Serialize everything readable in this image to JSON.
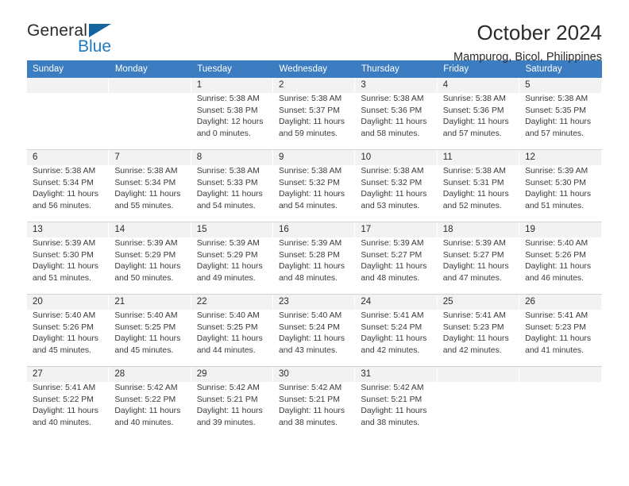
{
  "brand": {
    "name_part1": "General",
    "name_part2": "Blue",
    "flag_icon": "triangle-flag-icon",
    "accent_color": "#1f7ac0",
    "flag_color": "#1464a0"
  },
  "header": {
    "title": "October 2024",
    "subtitle": "Mampurog, Bicol, Philippines"
  },
  "calendar": {
    "header_bg": "#3b7dc0",
    "header_text_color": "#ffffff",
    "weekday_headers": [
      "Sunday",
      "Monday",
      "Tuesday",
      "Wednesday",
      "Thursday",
      "Friday",
      "Saturday"
    ],
    "weeks": [
      [
        {
          "day": "",
          "info": ""
        },
        {
          "day": "",
          "info": ""
        },
        {
          "day": "1",
          "info": "Sunrise: 5:38 AM\nSunset: 5:38 PM\nDaylight: 12 hours\nand 0 minutes."
        },
        {
          "day": "2",
          "info": "Sunrise: 5:38 AM\nSunset: 5:37 PM\nDaylight: 11 hours\nand 59 minutes."
        },
        {
          "day": "3",
          "info": "Sunrise: 5:38 AM\nSunset: 5:36 PM\nDaylight: 11 hours\nand 58 minutes."
        },
        {
          "day": "4",
          "info": "Sunrise: 5:38 AM\nSunset: 5:36 PM\nDaylight: 11 hours\nand 57 minutes."
        },
        {
          "day": "5",
          "info": "Sunrise: 5:38 AM\nSunset: 5:35 PM\nDaylight: 11 hours\nand 57 minutes."
        }
      ],
      [
        {
          "day": "6",
          "info": "Sunrise: 5:38 AM\nSunset: 5:34 PM\nDaylight: 11 hours\nand 56 minutes."
        },
        {
          "day": "7",
          "info": "Sunrise: 5:38 AM\nSunset: 5:34 PM\nDaylight: 11 hours\nand 55 minutes."
        },
        {
          "day": "8",
          "info": "Sunrise: 5:38 AM\nSunset: 5:33 PM\nDaylight: 11 hours\nand 54 minutes."
        },
        {
          "day": "9",
          "info": "Sunrise: 5:38 AM\nSunset: 5:32 PM\nDaylight: 11 hours\nand 54 minutes."
        },
        {
          "day": "10",
          "info": "Sunrise: 5:38 AM\nSunset: 5:32 PM\nDaylight: 11 hours\nand 53 minutes."
        },
        {
          "day": "11",
          "info": "Sunrise: 5:38 AM\nSunset: 5:31 PM\nDaylight: 11 hours\nand 52 minutes."
        },
        {
          "day": "12",
          "info": "Sunrise: 5:39 AM\nSunset: 5:30 PM\nDaylight: 11 hours\nand 51 minutes."
        }
      ],
      [
        {
          "day": "13",
          "info": "Sunrise: 5:39 AM\nSunset: 5:30 PM\nDaylight: 11 hours\nand 51 minutes."
        },
        {
          "day": "14",
          "info": "Sunrise: 5:39 AM\nSunset: 5:29 PM\nDaylight: 11 hours\nand 50 minutes."
        },
        {
          "day": "15",
          "info": "Sunrise: 5:39 AM\nSunset: 5:29 PM\nDaylight: 11 hours\nand 49 minutes."
        },
        {
          "day": "16",
          "info": "Sunrise: 5:39 AM\nSunset: 5:28 PM\nDaylight: 11 hours\nand 48 minutes."
        },
        {
          "day": "17",
          "info": "Sunrise: 5:39 AM\nSunset: 5:27 PM\nDaylight: 11 hours\nand 48 minutes."
        },
        {
          "day": "18",
          "info": "Sunrise: 5:39 AM\nSunset: 5:27 PM\nDaylight: 11 hours\nand 47 minutes."
        },
        {
          "day": "19",
          "info": "Sunrise: 5:40 AM\nSunset: 5:26 PM\nDaylight: 11 hours\nand 46 minutes."
        }
      ],
      [
        {
          "day": "20",
          "info": "Sunrise: 5:40 AM\nSunset: 5:26 PM\nDaylight: 11 hours\nand 45 minutes."
        },
        {
          "day": "21",
          "info": "Sunrise: 5:40 AM\nSunset: 5:25 PM\nDaylight: 11 hours\nand 45 minutes."
        },
        {
          "day": "22",
          "info": "Sunrise: 5:40 AM\nSunset: 5:25 PM\nDaylight: 11 hours\nand 44 minutes."
        },
        {
          "day": "23",
          "info": "Sunrise: 5:40 AM\nSunset: 5:24 PM\nDaylight: 11 hours\nand 43 minutes."
        },
        {
          "day": "24",
          "info": "Sunrise: 5:41 AM\nSunset: 5:24 PM\nDaylight: 11 hours\nand 42 minutes."
        },
        {
          "day": "25",
          "info": "Sunrise: 5:41 AM\nSunset: 5:23 PM\nDaylight: 11 hours\nand 42 minutes."
        },
        {
          "day": "26",
          "info": "Sunrise: 5:41 AM\nSunset: 5:23 PM\nDaylight: 11 hours\nand 41 minutes."
        }
      ],
      [
        {
          "day": "27",
          "info": "Sunrise: 5:41 AM\nSunset: 5:22 PM\nDaylight: 11 hours\nand 40 minutes."
        },
        {
          "day": "28",
          "info": "Sunrise: 5:42 AM\nSunset: 5:22 PM\nDaylight: 11 hours\nand 40 minutes."
        },
        {
          "day": "29",
          "info": "Sunrise: 5:42 AM\nSunset: 5:21 PM\nDaylight: 11 hours\nand 39 minutes."
        },
        {
          "day": "30",
          "info": "Sunrise: 5:42 AM\nSunset: 5:21 PM\nDaylight: 11 hours\nand 38 minutes."
        },
        {
          "day": "31",
          "info": "Sunrise: 5:42 AM\nSunset: 5:21 PM\nDaylight: 11 hours\nand 38 minutes."
        },
        {
          "day": "",
          "info": ""
        },
        {
          "day": "",
          "info": ""
        }
      ]
    ]
  }
}
